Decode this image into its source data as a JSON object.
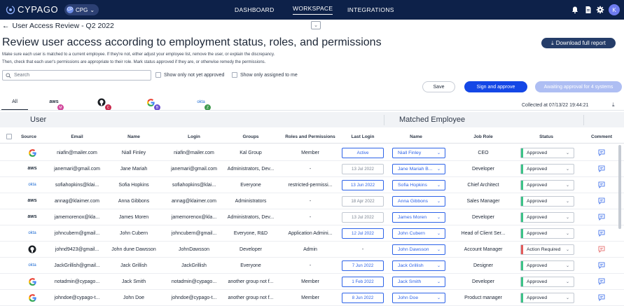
{
  "app": {
    "logo_text": "CYPAGO",
    "org_label": "CPG",
    "org_initials": "CP"
  },
  "nav": {
    "dashboard": "DASHBOARD",
    "workspace": "WORKSPACE",
    "integrations": "INTEGRATIONS",
    "avatar_initial": "K"
  },
  "header": {
    "back_icon": "arrow-left-icon",
    "breadcrumb": "User Access Review - Q2 2022",
    "title": "Review user access according to employment status, roles, and permissions",
    "desc_line1": "Make sure each user is matched to a current employee. If they're not, either adjust your employee list, remove the user, or explain the discrepancy.",
    "desc_line2": "Then, check that each user's permissions are appropriate to their role. Mark status approved if they are, or otherwise remedy the permissions.",
    "download_label": "Download full report"
  },
  "filters": {
    "search_placeholder": "Search",
    "only_not_approved": "Show only not yet approved",
    "only_assigned": "Show only assigned to me"
  },
  "actions": {
    "save": "Save",
    "sign": "Sign and approve",
    "awaiting": "Awaiting approval for 4 systems"
  },
  "source_tabs": {
    "all": "All",
    "aws_badge": "M",
    "github_badge": "C",
    "google_badge": "B",
    "okta_badge": "Z",
    "aws_text": "aws",
    "okta_text": "okta"
  },
  "collected_at": "Collected at 07/13/22 19:44:21",
  "table": {
    "section_user": "User",
    "section_matched": "Matched Employee",
    "headers": {
      "source": "Source",
      "email": "Email",
      "name": "Name",
      "login": "Login",
      "groups": "Groups",
      "roles": "Roles and Permissions",
      "last_login": "Last Login",
      "emp_name": "Name",
      "job_role": "Job Role",
      "status": "Status",
      "comment": "Comment"
    },
    "rows": [
      {
        "source": "google",
        "email": "niafin@mailer.com",
        "name": "Niall Finley",
        "login": "niafin@mailer.com",
        "groups": "Kal Group",
        "roles": "Member",
        "last_login": "Active",
        "last_login_highlight": true,
        "emp_name": "Niall Finley",
        "job_role": "CEO",
        "status": "Approved",
        "status_color": "#3cc287"
      },
      {
        "source": "aws",
        "email": "janemari@gmail.com",
        "name": "Jane Mariah",
        "login": "janemari@gmail.com",
        "groups": "Administrators, Dev...",
        "roles": "-",
        "last_login": "13 Jul 2022",
        "last_login_highlight": false,
        "emp_name": "Jane Mariah B...",
        "job_role": "Developer",
        "status": "Approved",
        "status_color": "#3cc287"
      },
      {
        "source": "okta",
        "email": "sofiahopkins@klai...",
        "name": "Sofia Hopkins",
        "login": "sofiahopkins@klai...",
        "groups": "Everyone",
        "roles": "restricted-permissi...",
        "last_login": "13 Jun 2022",
        "last_login_highlight": true,
        "emp_name": "Sofia Hopkins",
        "job_role": "Chief Architect",
        "status": "Approved",
        "status_color": "#3cc287"
      },
      {
        "source": "aws",
        "email": "annag@klaimer.com",
        "name": "Anna Gibbons",
        "login": "annag@klaimer.com",
        "groups": "Administrators",
        "roles": "-",
        "last_login": "18 Apr 2022",
        "last_login_highlight": false,
        "emp_name": "Anna Gibbons",
        "job_role": "Sales Manager",
        "status": "Approved",
        "status_color": "#3cc287"
      },
      {
        "source": "aws",
        "email": "jamemorenox@kla...",
        "name": "James Moren",
        "login": "jamemorenox@kla...",
        "groups": "Administrators, Dev...",
        "roles": "-",
        "last_login": "13 Jul 2022",
        "last_login_highlight": false,
        "emp_name": "James Moren",
        "job_role": "Developer",
        "status": "Approved",
        "status_color": "#3cc287"
      },
      {
        "source": "okta",
        "email": "johncubern@gmail...",
        "name": "John Cubern",
        "login": "johncubern@gmail...",
        "groups": "Everyone, R&D",
        "roles": "Application Admini...",
        "last_login": "12 Jul 2022",
        "last_login_highlight": true,
        "emp_name": "John Cubern",
        "job_role": "Head of Client Ser...",
        "status": "Approved",
        "status_color": "#3cc287"
      },
      {
        "source": "github",
        "email": "johnd9423@gmail...",
        "name": "John dune Dawsson",
        "login": "JohnDawsson",
        "groups": "Developer",
        "roles": "Admin",
        "last_login": "-",
        "last_login_highlight": null,
        "emp_name": "John Dawsson",
        "job_role": "Account Manager",
        "status": "Action Required",
        "status_color": "#e35b5b"
      },
      {
        "source": "okta",
        "email": "JackGrillish@gmail...",
        "name": "Jack Grillish",
        "login": "JackGrillish",
        "groups": "Everyone",
        "roles": "-",
        "last_login": "7 Jun 2022",
        "last_login_highlight": true,
        "emp_name": "Jack Grillish",
        "job_role": "Designer",
        "status": "Approved",
        "status_color": "#3cc287"
      },
      {
        "source": "google",
        "email": "notadmin@cypago...",
        "name": "Jack Smith",
        "login": "notadmin@cypago...",
        "groups": "another group not f...",
        "roles": "Member",
        "last_login": "1 Feb 2022",
        "last_login_highlight": true,
        "emp_name": "Jack Smith",
        "job_role": "Developer",
        "status": "Approved",
        "status_color": "#3cc287"
      },
      {
        "source": "google",
        "email": "johndoe@cypago-t...",
        "name": "John Doe",
        "login": "johndoe@cypago-t...",
        "groups": "another group not f...",
        "roles": "Member",
        "last_login": "8 Jun 2022",
        "last_login_highlight": true,
        "emp_name": "John Doe",
        "job_role": "Product manager",
        "status": "Approved",
        "status_color": "#3cc287"
      }
    ]
  }
}
